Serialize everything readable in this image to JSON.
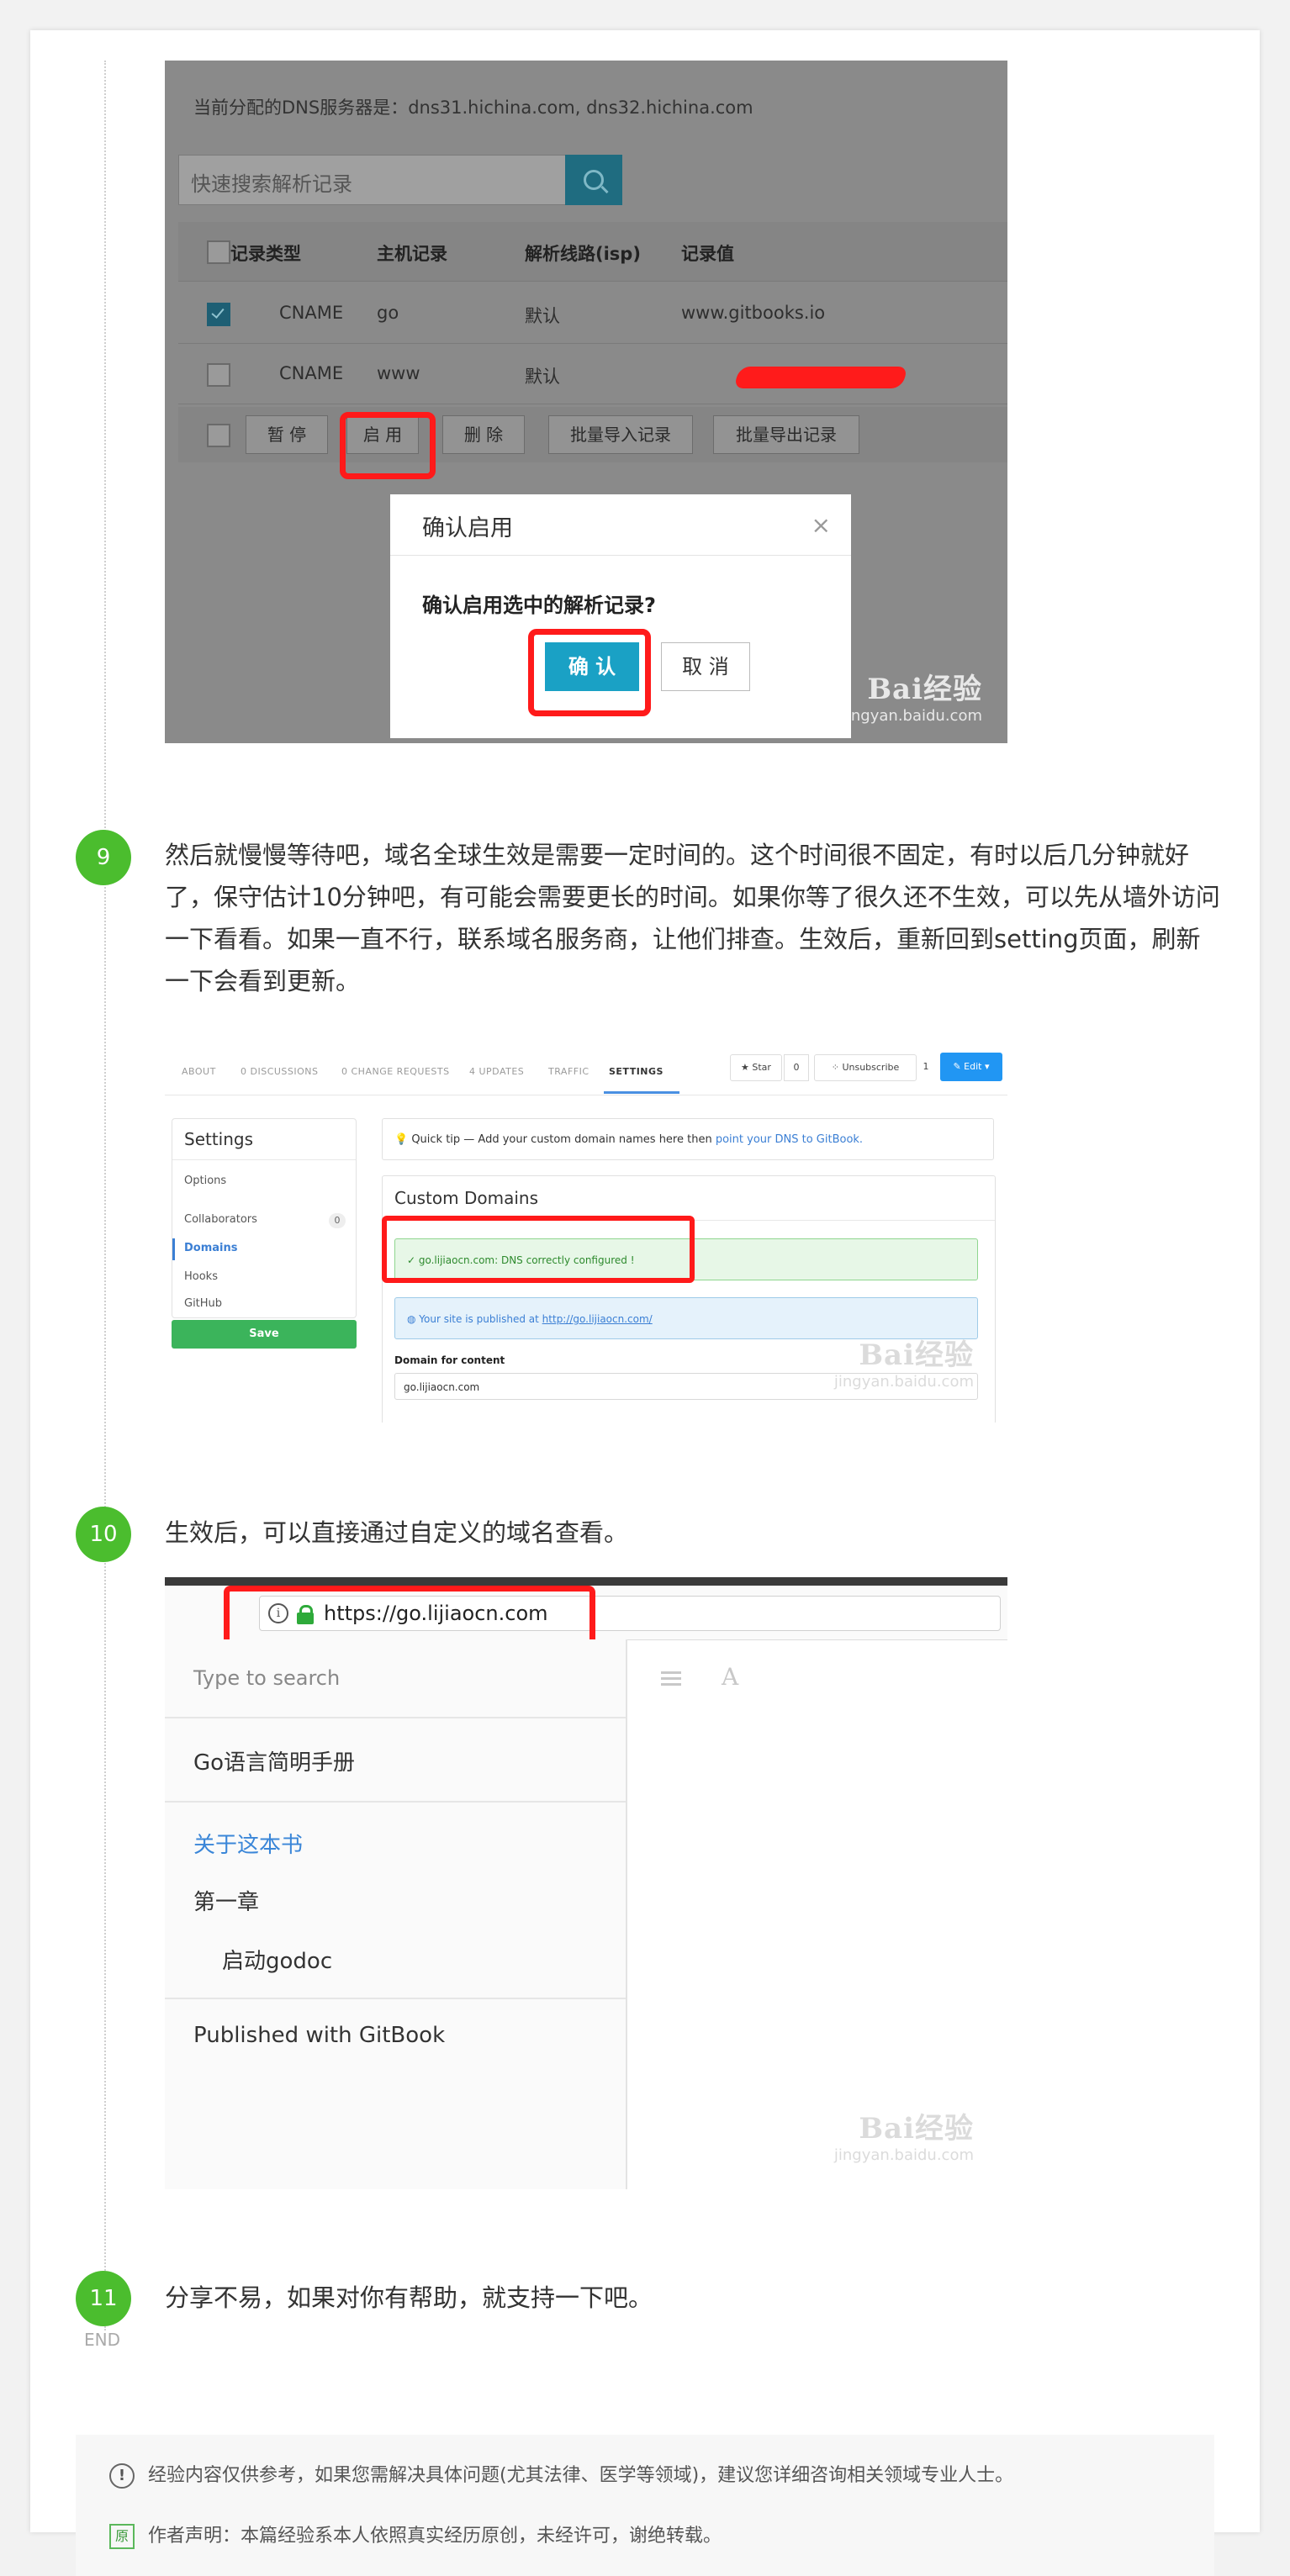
{
  "dns_screenshot": {
    "ns_info": "当前分配的DNS服务器是：dns31.hichina.com, dns32.hichina.com",
    "search_placeholder": "快速搜索解析记录",
    "columns": [
      "记录类型",
      "主机记录",
      "解析线路(isp)",
      "记录值"
    ],
    "rows": [
      {
        "type": "CNAME",
        "host": "go",
        "line": "默认",
        "value": "www.gitbooks.io",
        "checked": true
      },
      {
        "type": "CNAME",
        "host": "www",
        "line": "默认",
        "value": "",
        "checked": false
      }
    ],
    "actions": [
      "暂 停",
      "启 用",
      "删 除",
      "批量导入记录",
      "批量导出记录"
    ],
    "dialog": {
      "title": "确认启用",
      "message": "确认启用选中的解析记录?",
      "ok": "确 认",
      "cancel": "取 消"
    }
  },
  "watermark": {
    "brand": "Bai经验",
    "site": "jingyan.baidu.com"
  },
  "steps": [
    {
      "number": "9",
      "text": "然后就慢慢等待吧，域名全球生效是需要一定时间的。这个时间很不固定，有时以后几分钟就好了，保守估计10分钟吧，有可能会需要更长的时间。如果你等了很久还不生效，可以先从墙外访问一下看看。如果一直不行，联系域名服务商，让他们排查。生效后，重新回到setting页面，刷新一下会看到更新。"
    },
    {
      "number": "10",
      "text": "生效后，可以直接通过自定义的域名查看。"
    },
    {
      "number": "11",
      "text": "分享不易，如果对你有帮助，就支持一下吧。"
    }
  ],
  "end_label": "END",
  "gitbook_screenshot": {
    "nav": [
      "ABOUT",
      "0 DISCUSSIONS",
      "0 CHANGE REQUESTS",
      "4 UPDATES",
      "TRAFFIC",
      "SETTINGS"
    ],
    "star_label": "★ Star",
    "star_count": "0",
    "unsubscribe_label": "⁘ Unsubscribe",
    "unsubscribe_count": "1",
    "edit_label": "✎ Edit  ▾",
    "sidebar_title": "Settings",
    "sidebar_items": [
      "Options",
      "Collaborators",
      "Domains",
      "Hooks",
      "GitHub"
    ],
    "collaborators_count": "0",
    "save_label": "Save",
    "tip_prefix": "💡 Quick tip — Add your custom domain names here then ",
    "tip_link": "point your DNS to GitBook.",
    "panel_title": "Custom Domains",
    "success_msg": "✓ go.lijiaocn.com: DNS correctly configured !",
    "info_prefix": "◍ Your site is published at ",
    "info_link": "http://go.lijiaocn.com/",
    "field_label": "Domain for content",
    "field_value": "go.lijiaocn.com"
  },
  "site_screenshot": {
    "url": "https://go.lijiaocn.com",
    "search_placeholder": "Type to search",
    "book_title": "Go语言简明手册",
    "about_link": "关于这本书",
    "chapter": "第一章",
    "section": "启动godoc",
    "published": "Published with GitBook",
    "font_icon": "A"
  },
  "disclaimer": {
    "notice": "经验内容仅供参考，如果您需解决具体问题(尤其法律、医学等领域)，建议您详细咨询相关领域专业人士。",
    "author": "作者声明：本篇经验系本人依照真实经历原创，未经许可，谢绝转载。",
    "notice_icon": "!",
    "author_icon": "原"
  },
  "colors": {
    "step_badge": "#4bbd2e",
    "highlight": "#ff1a1a",
    "link": "#3b7fd4"
  }
}
